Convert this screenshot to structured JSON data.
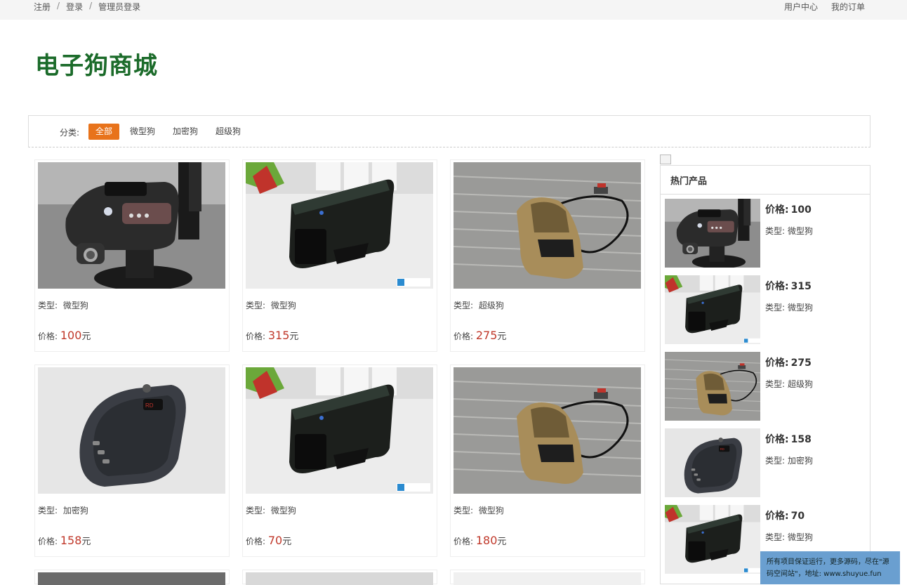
{
  "nav": {
    "register": "注册",
    "login": "登录",
    "admin_login": "管理员登录",
    "separator": "/",
    "user_center": "用户中心",
    "my_orders": "我的订单"
  },
  "site_title": "电子狗商城",
  "categories": {
    "label": "分类:",
    "items": [
      "全部",
      "微型狗",
      "加密狗",
      "超级狗"
    ],
    "active": "全部"
  },
  "products": [
    {
      "type_label": "类型:",
      "type": "微型狗",
      "price_label": "价格:",
      "price": "100",
      "unit": "元",
      "image": "mount-detector"
    },
    {
      "type_label": "类型:",
      "type": "微型狗",
      "price_label": "价格:",
      "price": "315",
      "unit": "元",
      "image": "black-detector"
    },
    {
      "type_label": "类型:",
      "type": "超级狗",
      "price_label": "价格:",
      "price": "275",
      "unit": "元",
      "image": "gold-car"
    },
    {
      "type_label": "类型:",
      "type": "加密狗",
      "price_label": "价格:",
      "price": "158",
      "unit": "元",
      "image": "oval-detector"
    },
    {
      "type_label": "类型:",
      "type": "微型狗",
      "price_label": "价格:",
      "price": "70",
      "unit": "元",
      "image": "black-detector"
    },
    {
      "type_label": "类型:",
      "type": "微型狗",
      "price_label": "价格:",
      "price": "180",
      "unit": "元",
      "image": "gold-car"
    }
  ],
  "hot_products": {
    "title": "热门产品",
    "items": [
      {
        "price_label": "价格:",
        "price": "100",
        "type_label": "类型:",
        "type": "微型狗",
        "image": "mount-detector"
      },
      {
        "price_label": "价格:",
        "price": "315",
        "type_label": "类型:",
        "type": "微型狗",
        "image": "black-detector"
      },
      {
        "price_label": "价格:",
        "price": "275",
        "type_label": "类型:",
        "type": "超级狗",
        "image": "gold-car"
      },
      {
        "price_label": "价格:",
        "price": "158",
        "type_label": "类型:",
        "type": "加密狗",
        "image": "oval-detector"
      },
      {
        "price_label": "价格:",
        "price": "70",
        "type_label": "类型:",
        "type": "微型狗",
        "image": "black-detector"
      }
    ]
  },
  "notice": "所有项目保证运行，更多源码，尽在\"源码空间站\"，地址: www.shuyue.fun",
  "colors": {
    "brand": "#1b6b2a",
    "accent": "#e8731b",
    "price": "#c0392b",
    "notice_bg": "#6a9fd0"
  }
}
